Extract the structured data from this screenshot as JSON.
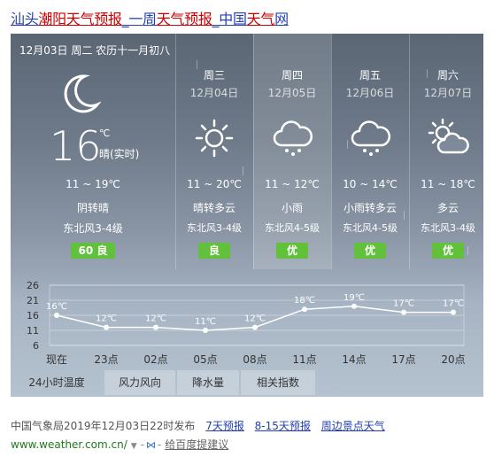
{
  "title": {
    "part1": "汕头",
    "part2": "潮阳天气",
    "part3": "预报",
    "part4": "_一周",
    "part5": "天气",
    "part6": "预报",
    "part7": "_中国",
    "part8": "天气",
    "part9": "网"
  },
  "current": {
    "date_line": "12月03日 周二 农历十一月初八",
    "temp": "16",
    "unit": "℃",
    "desc": "晴(实时)",
    "icon": "moon-icon",
    "range": "11 ~ 19℃",
    "condition": "阴转晴",
    "wind": "东北风3-4级",
    "aqi": "60 良"
  },
  "days": [
    {
      "name": "周三",
      "date": "12月04日",
      "icon": "sun-icon",
      "range": "11 ~ 20℃",
      "condition": "晴转多云",
      "wind": "东北风3-4级",
      "aqi": "良"
    },
    {
      "name": "周四",
      "date": "12月05日",
      "icon": "rain-cloud-icon",
      "range": "11 ~ 12℃",
      "condition": "小雨",
      "wind": "东北风4-5级",
      "aqi": "优"
    },
    {
      "name": "周五",
      "date": "12月06日",
      "icon": "rain-cloud-icon",
      "range": "10 ~ 14℃",
      "condition": "小雨转多云",
      "wind": "东北风4-5级",
      "aqi": "优"
    },
    {
      "name": "周六",
      "date": "12月07日",
      "icon": "partly-cloudy-icon",
      "range": "11 ~ 18℃",
      "condition": "多云",
      "wind": "东北风3-4级",
      "aqi": "优"
    }
  ],
  "chart_data": {
    "type": "line",
    "x": [
      "现在",
      "23点",
      "02点",
      "05点",
      "08点",
      "11点",
      "14点",
      "17点",
      "20点"
    ],
    "values": [
      16,
      12,
      12,
      11,
      12,
      18,
      19,
      17,
      17
    ],
    "labels": [
      "16℃",
      "12℃",
      "12℃",
      "11℃",
      "12℃",
      "18℃",
      "19℃",
      "17℃",
      "17℃"
    ],
    "yticks": [
      "26",
      "21",
      "16",
      "11",
      "6"
    ],
    "ylim": [
      6,
      26
    ],
    "grid": true
  },
  "tabs": [
    "24小时温度",
    "风力风向",
    "降水量",
    "相关指数"
  ],
  "footer": {
    "publish": "中国气象局2019年12月03日22时发布",
    "links": [
      "7天预报",
      "8-15天预报",
      "周边景点天气"
    ],
    "url": "www.weather.com.cn/",
    "feedback": "给百度提建议"
  },
  "colors": {
    "aqi_good": "#62c13b",
    "link": "#2440b3",
    "highlight": "#cc0000",
    "url_green": "#1f7a1f"
  }
}
